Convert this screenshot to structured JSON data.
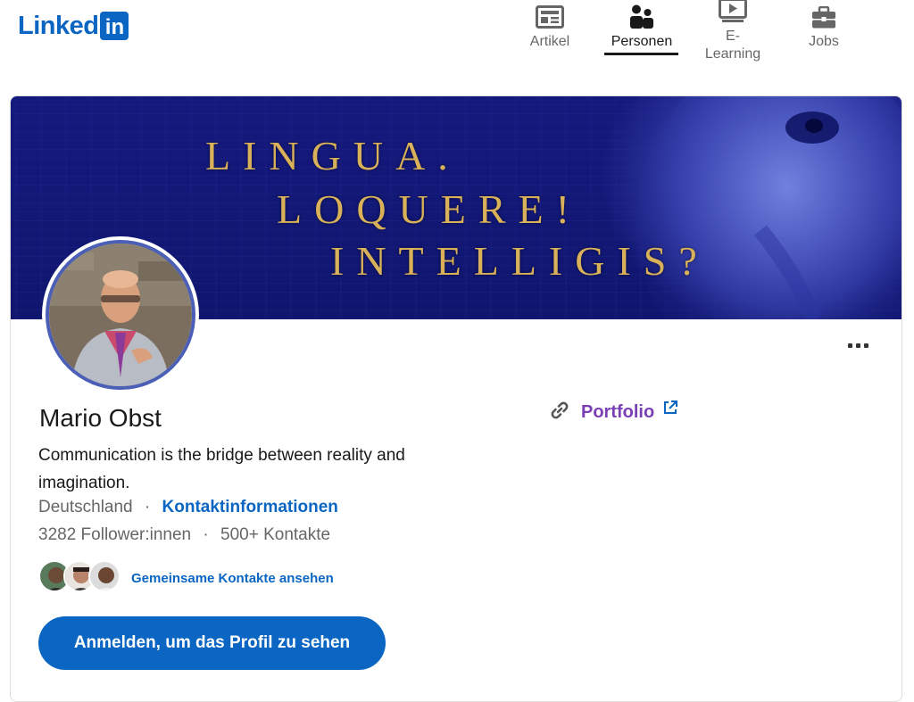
{
  "brand": {
    "logo_text": "Linked",
    "logo_box": "in",
    "color": "#0a66c2"
  },
  "nav": {
    "items": [
      {
        "label": "Artikel",
        "icon": "article-icon",
        "active": false
      },
      {
        "label": "Personen",
        "icon": "people-icon",
        "active": true
      },
      {
        "label_line1": "E-",
        "label_line2": "Learning",
        "icon": "video-icon",
        "active": false
      },
      {
        "label": "Jobs",
        "icon": "briefcase-icon",
        "active": false
      }
    ]
  },
  "banner": {
    "lines": [
      "LINGUA.",
      "LOQUERE!",
      "INTELLIGIS?"
    ],
    "text_color": "#d9b15a",
    "background": "#14197d"
  },
  "profile": {
    "name": "Mario Obst",
    "headline": "Communication is the bridge between reality and imagination.",
    "location": "Deutschland",
    "separator": "·",
    "contact_link": "Kontaktinformationen",
    "followers": "3282 Follower:innen",
    "connections": "500+ Kontakte",
    "mutual_link": "Gemeinsame Kontakte ansehen",
    "cta_button": "Anmelden, um das Profil zu sehen"
  },
  "portfolio": {
    "label": "Portfolio",
    "color": "#7a3eb5"
  }
}
